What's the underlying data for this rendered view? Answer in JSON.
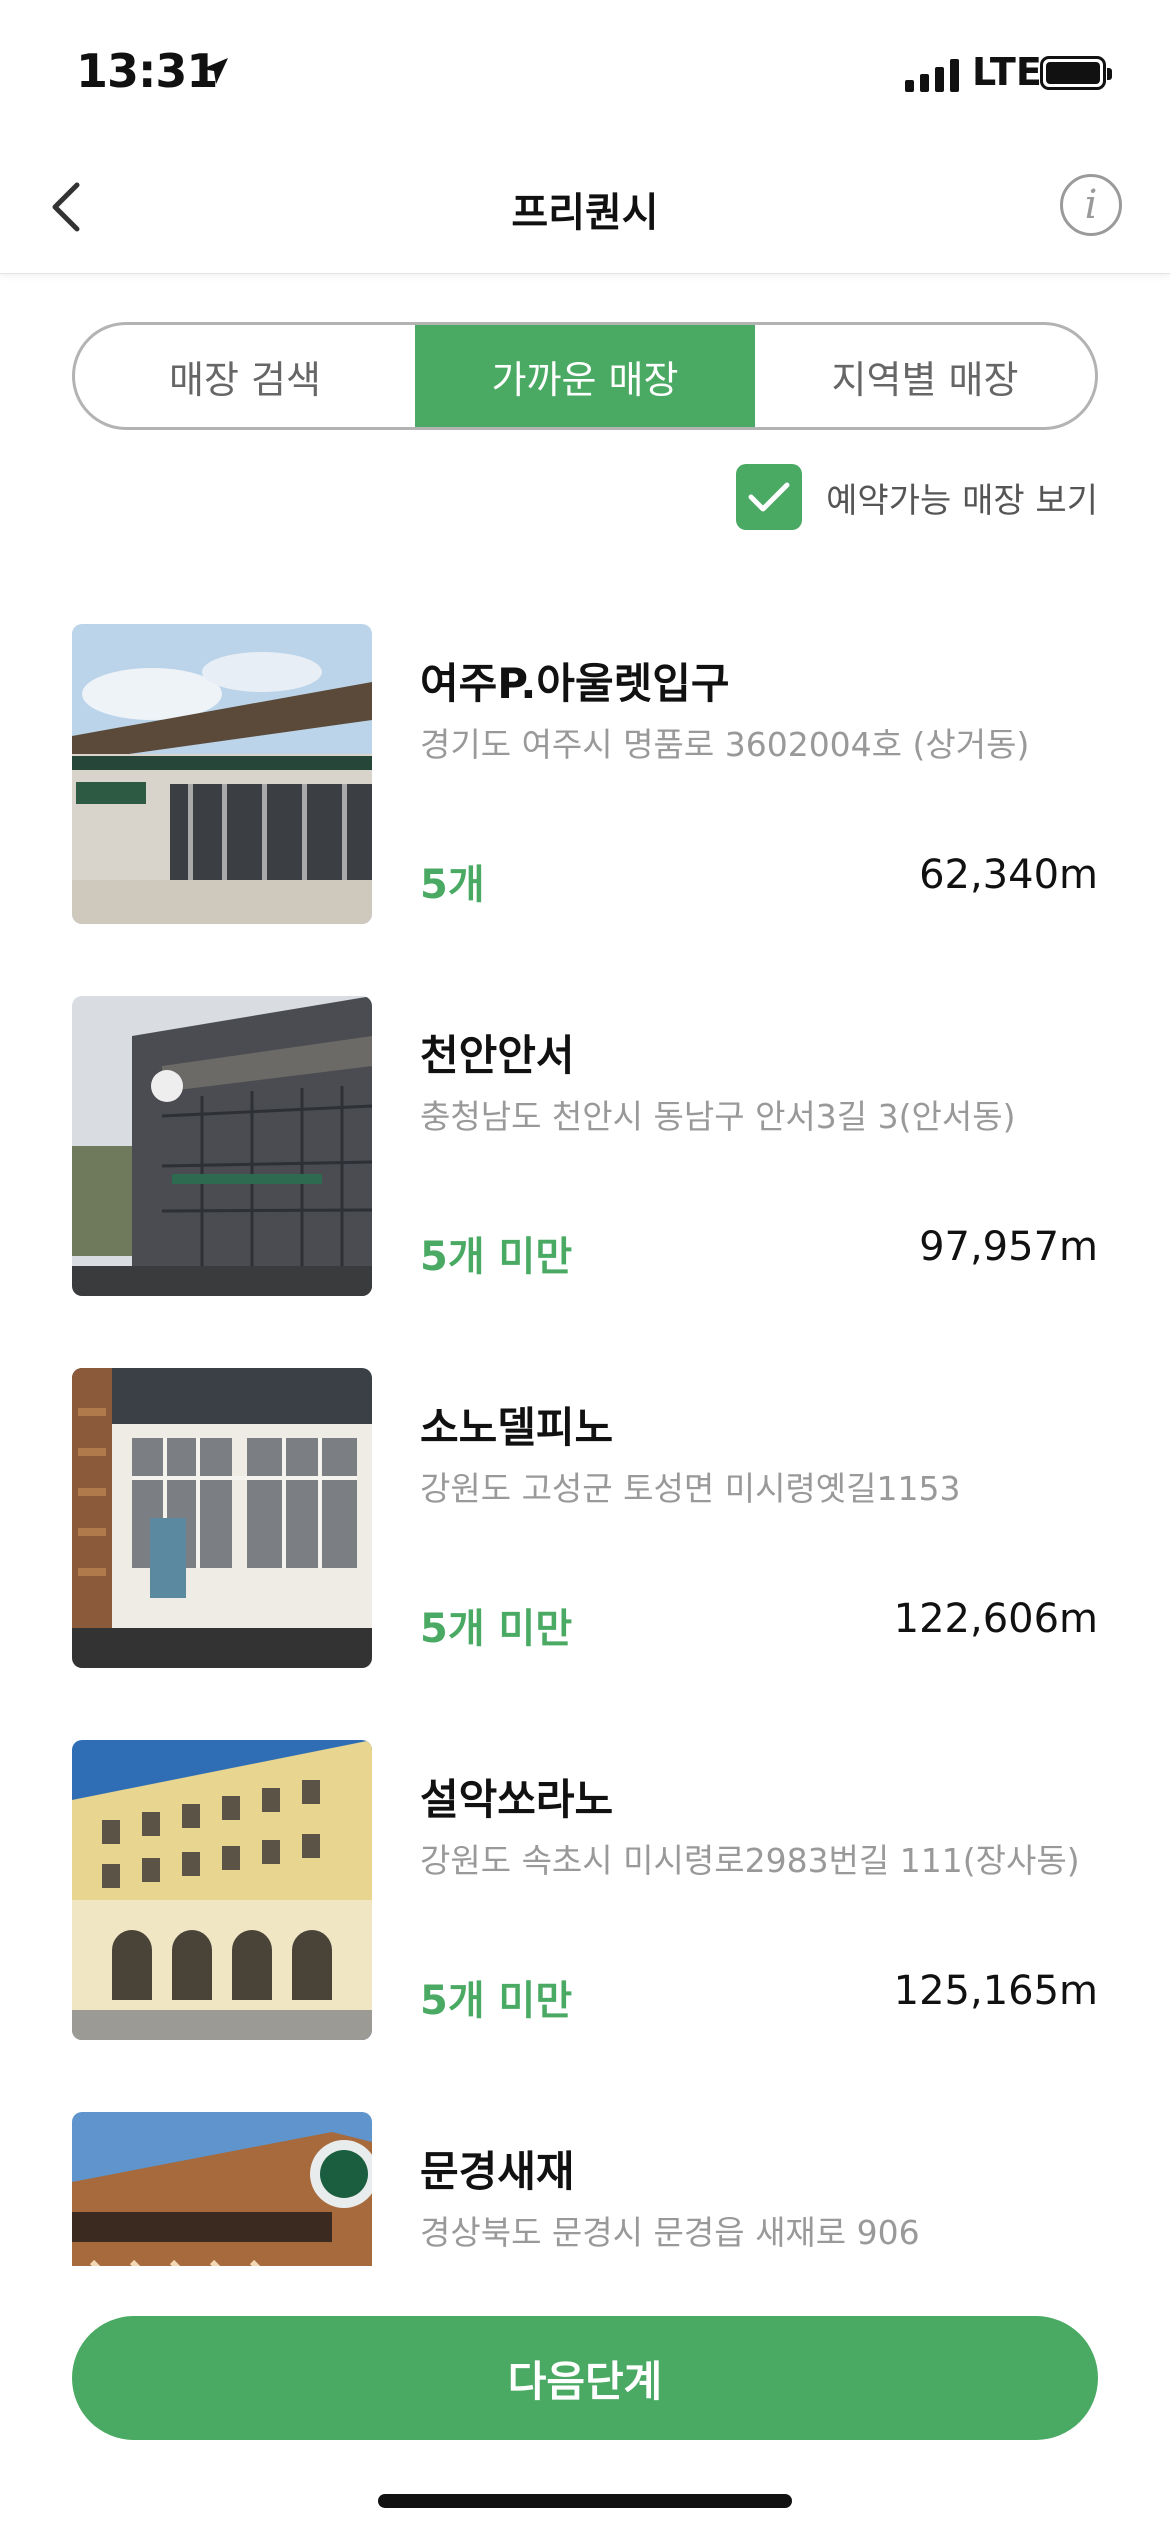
{
  "status_bar": {
    "time": "13:31",
    "network": "LTE",
    "icons": [
      "location-arrow-icon",
      "signal-bars-icon",
      "battery-icon"
    ]
  },
  "nav": {
    "title": "프리퀀시",
    "back_icon": "chevron-left-icon",
    "info_icon": "info-icon",
    "info_glyph": "i"
  },
  "tabs": [
    {
      "label": "매장 검색",
      "active": false
    },
    {
      "label": "가까운 매장",
      "active": true
    },
    {
      "label": "지역별 매장",
      "active": false
    }
  ],
  "filter": {
    "label": "예약가능 매장 보기",
    "checked": true
  },
  "stores": [
    {
      "name": "여주P.아울렛입구",
      "address": "경기도 여주시 명품로 3602004호 (상거동)",
      "count": "5개",
      "distance": "62,340m"
    },
    {
      "name": "천안안서",
      "address": "충청남도 천안시 동남구 안서3길 3(안서동)",
      "count": "5개 미만",
      "distance": "97,957m"
    },
    {
      "name": "소노델피노",
      "address": "강원도 고성군 토성면 미시령옛길1153",
      "count": "5개 미만",
      "distance": "122,606m"
    },
    {
      "name": "설악쏘라노",
      "address": "강원도 속초시 미시령로2983번길 111(장사동)",
      "count": "5개 미만",
      "distance": "125,165m"
    },
    {
      "name": "문경새재",
      "address": "경상북도 문경시 문경읍 새재로 906",
      "count": "",
      "distance": ""
    }
  ],
  "next_button": {
    "label": "다음단계"
  },
  "colors": {
    "accent": "#4aaa63",
    "text": "#111111",
    "muted": "#999999"
  }
}
